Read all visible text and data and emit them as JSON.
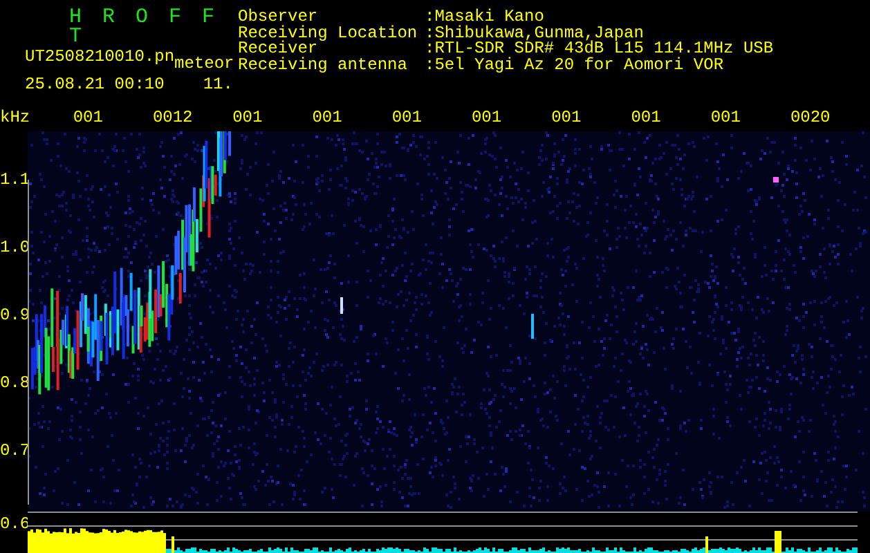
{
  "header": {
    "title": "H R O F F T",
    "file": "UT2508210010.pn",
    "mode": "meteor",
    "timestamp": "25.08.21 00:10",
    "count": "11."
  },
  "info": [
    {
      "label": "Observer",
      "value": ":Masaki Kano"
    },
    {
      "label": "Receiving Location",
      "value": ":Shibukawa,Gunma,Japan"
    },
    {
      "label": "Receiver",
      "value": ":RTL-SDR SDR# 43dB L15 114.1MHz USB"
    },
    {
      "label": "Receiving antenna",
      "value": ":5el Yagi Az 20 for Aomori VOR"
    }
  ],
  "spectrogram": {
    "unit": "kHz",
    "time_labels": [
      "001",
      "0012",
      "001",
      "001",
      "001",
      "001",
      "001",
      "001",
      "001",
      "0020"
    ],
    "freq_labels": [
      "1.1",
      "1.0",
      "0.9",
      "0.8",
      "0.7"
    ],
    "bottom_label": "0.6"
  }
}
